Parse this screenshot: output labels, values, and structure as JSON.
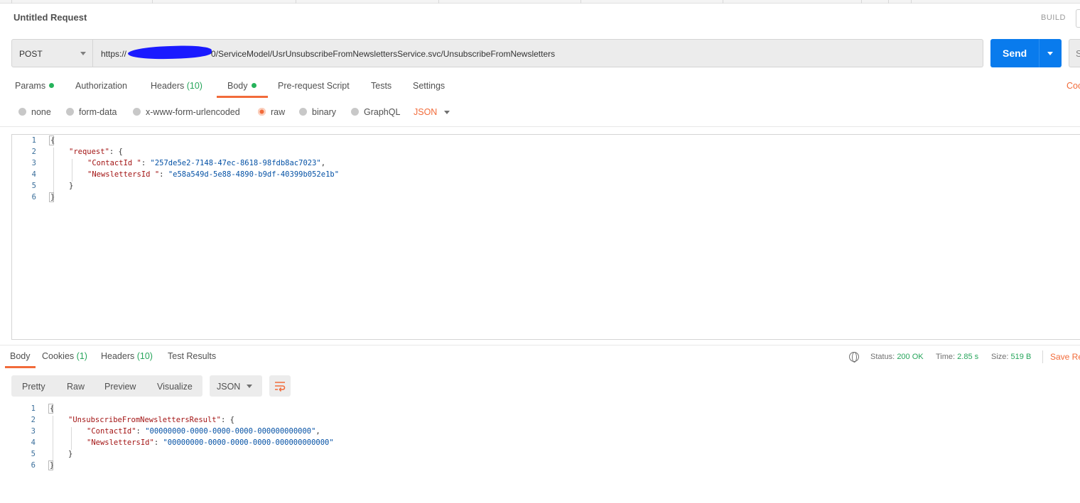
{
  "request": {
    "title": "Untitled Request",
    "build_label": "BUILD",
    "method": "POST",
    "url_prefix": "https://",
    "url_rest": "0/ServiceModel/UsrUnsubscribeFromNewslettersService.svc/UnsubscribeFromNewsletters",
    "send_label": "Send",
    "save_partial": "S",
    "code_link": "Coc"
  },
  "request_tabs": [
    {
      "label": "Params",
      "dot": true
    },
    {
      "label": "Authorization"
    },
    {
      "label": "Headers",
      "count": "(10)"
    },
    {
      "label": "Body",
      "dot": true,
      "active": true
    },
    {
      "label": "Pre-request Script"
    },
    {
      "label": "Tests"
    },
    {
      "label": "Settings"
    }
  ],
  "body_types": [
    {
      "label": "none"
    },
    {
      "label": "form-data"
    },
    {
      "label": "x-www-form-urlencoded"
    },
    {
      "label": "raw",
      "selected": true
    },
    {
      "label": "binary"
    },
    {
      "label": "GraphQL"
    }
  ],
  "body_format": "JSON",
  "request_body": [
    {
      "n": "1",
      "parts": [
        [
          "p",
          "{"
        ]
      ]
    },
    {
      "n": "2",
      "parts": [
        [
          "k",
          "\"request\""
        ],
        [
          "p",
          ": {"
        ]
      ]
    },
    {
      "n": "3",
      "parts": [
        [
          "k",
          "\"ContactId \""
        ],
        [
          "p",
          ": "
        ],
        [
          "s",
          "\"257de5e2-7148-47ec-8618-98fdb8ac7023\""
        ],
        [
          "p",
          ","
        ]
      ]
    },
    {
      "n": "4",
      "parts": [
        [
          "k",
          "\"NewslettersId \""
        ],
        [
          "p",
          ": "
        ],
        [
          "s",
          "\"e58a549d-5e88-4890-b9df-40399b052e1b\""
        ]
      ]
    },
    {
      "n": "5",
      "parts": [
        [
          "p",
          "}"
        ]
      ]
    },
    {
      "n": "6",
      "parts": [
        [
          "p",
          "}"
        ]
      ]
    }
  ],
  "response_tabs": [
    {
      "label": "Body",
      "active": true
    },
    {
      "label": "Cookies",
      "count": "(1)"
    },
    {
      "label": "Headers",
      "count": "(10)"
    },
    {
      "label": "Test Results"
    }
  ],
  "response_status": {
    "status_label": "Status:",
    "status_value": "200 OK",
    "time_label": "Time:",
    "time_value": "2.85 s",
    "size_label": "Size:",
    "size_value": "519 B",
    "save_response": "Save Re"
  },
  "view_modes": [
    "Pretty",
    "Raw",
    "Preview",
    "Visualize"
  ],
  "response_format": "JSON",
  "response_body": [
    {
      "n": "1",
      "parts": [
        [
          "p",
          "{"
        ]
      ]
    },
    {
      "n": "2",
      "parts": [
        [
          "k",
          "\"UnsubscribeFromNewslettersResult\""
        ],
        [
          "p",
          ": {"
        ]
      ]
    },
    {
      "n": "3",
      "parts": [
        [
          "k",
          "\"ContactId\""
        ],
        [
          "p",
          ": "
        ],
        [
          "s",
          "\"00000000-0000-0000-0000-000000000000\""
        ],
        [
          "p",
          ","
        ]
      ]
    },
    {
      "n": "4",
      "parts": [
        [
          "k",
          "\"NewslettersId\""
        ],
        [
          "p",
          ": "
        ],
        [
          "s",
          "\"00000000-0000-0000-0000-000000000000\""
        ]
      ]
    },
    {
      "n": "5",
      "parts": [
        [
          "p",
          "}"
        ]
      ]
    },
    {
      "n": "6",
      "parts": [
        [
          "p",
          "}"
        ]
      ]
    }
  ],
  "colors": {
    "accent": "#f26b3a",
    "send": "#097bed",
    "success": "#26a55b"
  },
  "icons": [
    "chevron-down-icon",
    "globe-icon",
    "wrap-lines-icon"
  ]
}
